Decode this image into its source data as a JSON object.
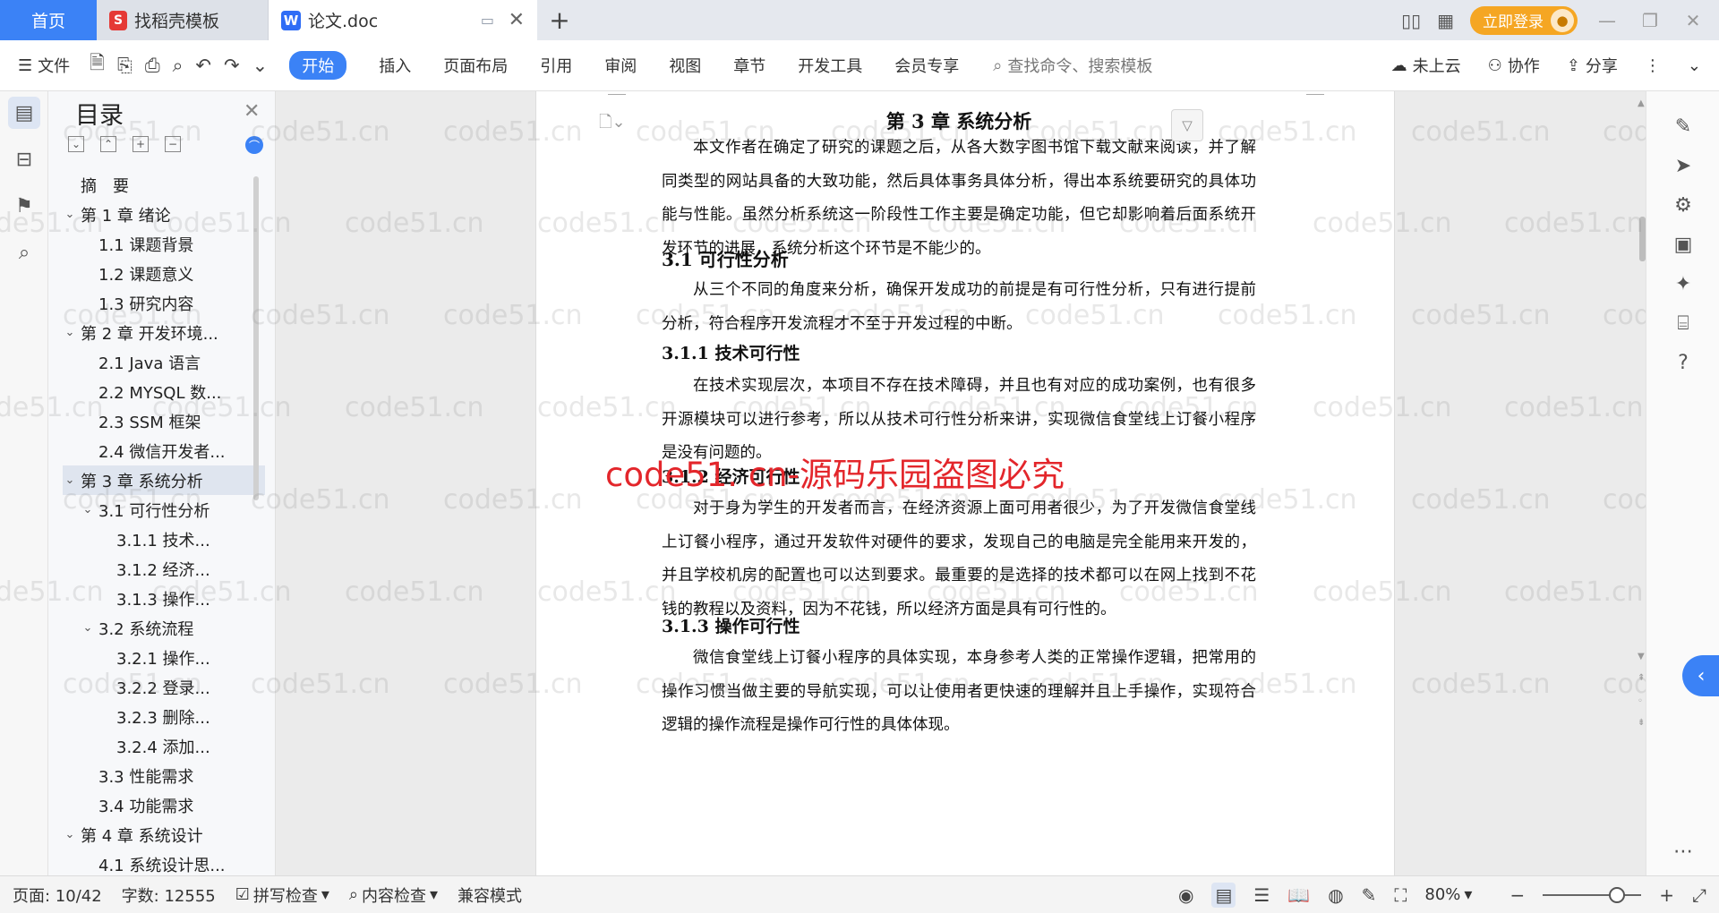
{
  "titlebar": {
    "tabs": [
      {
        "label": "首页"
      },
      {
        "label": "找稻壳模板"
      },
      {
        "label": "论文.doc"
      }
    ],
    "login_label": "立即登录"
  },
  "menubar": {
    "file_label": "文件",
    "items": [
      "开始",
      "插入",
      "页面布局",
      "引用",
      "审阅",
      "视图",
      "章节",
      "开发工具",
      "会员专享"
    ],
    "active_index": 0,
    "search_placeholder": "查找命令、搜索模板",
    "right": {
      "cloud": "未上云",
      "collab": "协作",
      "share": "分享"
    }
  },
  "toc": {
    "title": "目录",
    "items": [
      {
        "label": "摘　要",
        "level": 0,
        "arrow": ""
      },
      {
        "label": "第 1 章  绪论",
        "level": 0,
        "arrow": "v"
      },
      {
        "label": "1.1  课题背景",
        "level": 1,
        "arrow": ""
      },
      {
        "label": "1.2  课题意义",
        "level": 1,
        "arrow": ""
      },
      {
        "label": "1.3  研究内容",
        "level": 1,
        "arrow": ""
      },
      {
        "label": "第 2 章  开发环境...",
        "level": 0,
        "arrow": "v"
      },
      {
        "label": "2.1 Java 语言",
        "level": 1,
        "arrow": ""
      },
      {
        "label": "2.2 MYSQL 数...",
        "level": 1,
        "arrow": ""
      },
      {
        "label": "2.3 SSM 框架",
        "level": 1,
        "arrow": ""
      },
      {
        "label": "2.4 微信开发者...",
        "level": 1,
        "arrow": ""
      },
      {
        "label": "第 3 章  系统分析",
        "level": 0,
        "arrow": "v",
        "selected": true
      },
      {
        "label": "3.1  可行性分析",
        "level": 1,
        "arrow": "v"
      },
      {
        "label": "3.1.1  技术...",
        "level": 2,
        "arrow": ""
      },
      {
        "label": "3.1.2  经济...",
        "level": 2,
        "arrow": ""
      },
      {
        "label": "3.1.3  操作...",
        "level": 2,
        "arrow": ""
      },
      {
        "label": "3.2  系统流程",
        "level": 1,
        "arrow": "v"
      },
      {
        "label": "3.2.1  操作...",
        "level": 2,
        "arrow": ""
      },
      {
        "label": "3.2.2  登录...",
        "level": 2,
        "arrow": ""
      },
      {
        "label": "3.2.3  删除...",
        "level": 2,
        "arrow": ""
      },
      {
        "label": "3.2.4  添加...",
        "level": 2,
        "arrow": ""
      },
      {
        "label": "3.3  性能需求",
        "level": 1,
        "arrow": ""
      },
      {
        "label": "3.4  功能需求",
        "level": 1,
        "arrow": ""
      },
      {
        "label": "第 4 章  系统设计",
        "level": 0,
        "arrow": "v"
      },
      {
        "label": "4.1  系统设计思...",
        "level": 1,
        "arrow": ""
      }
    ]
  },
  "document": {
    "chapter_title": "第 3 章  系统分析",
    "p1": "本文作者在确定了研究的课题之后，从各大数字图书馆下载文献来阅读，并了解同类型的网站具备的大致功能，然后具体事务具体分析，得出本系统要研究的具体功能与性能。虽然分析系统这一阶段性工作主要是确定功能，但它却影响着后面系统开发环节的进展，系统分析这个环节是不能少的。",
    "h31": "3.1  可行性分析",
    "p2": "从三个不同的角度来分析，确保开发成功的前提是有可行性分析，只有进行提前分析，符合程序开发流程才不至于开发过程的中断。",
    "h311": "3.1.1  技术可行性",
    "p3": "在技术实现层次，本项目不存在技术障碍，并且也有对应的成功案例，也有很多开源模块可以进行参考，所以从技术可行性分析来讲，实现微信食堂线上订餐小程序是没有问题的。",
    "h312": "3.1.2  经济可行性",
    "p4": "对于身为学生的开发者而言，在经济资源上面可用者很少，为了开发微信食堂线上订餐小程序，通过开发软件对硬件的要求，发现自己的电脑是完全能用来开发的，并且学校机房的配置也可以达到要求。最重要的是选择的技术都可以在网上找到不花钱的教程以及资料，因为不花钱，所以经济方面是具有可行性的。",
    "h313": "3.1.3  操作可行性",
    "p5": "微信食堂线上订餐小程序的具体实现，本身参考人类的正常操作逻辑，把常用的操作习惯当做主要的导航实现，可以让使用者更快速的理解并且上手操作，实现符合逻辑的操作流程是操作可行性的具体体现。"
  },
  "watermark": {
    "text": "code51.cn",
    "big": "code51. cn-源码乐园盗图必究"
  },
  "statusbar": {
    "page": "页面: 10/42",
    "words": "字数: 12555",
    "spell": "拼写检查",
    "content_check": "内容检查",
    "compat": "兼容模式",
    "zoom": "80%"
  },
  "icons": [
    "menu-icon",
    "save-icon",
    "export-icon",
    "print-icon",
    "preview-icon",
    "undo-icon",
    "redo-icon",
    "search-icon",
    "cloud-icon",
    "user-icon",
    "share-icon",
    "toc-icon",
    "bookmark-icon",
    "pen-icon",
    "cursor-icon",
    "settings-icon",
    "help-icon",
    "eye-icon",
    "zoom-out-icon",
    "zoom-in-icon",
    "fullscreen-icon"
  ],
  "colors": {
    "accent": "#3b82f6",
    "login": "#f5a623",
    "watermark_red": "#e3262b"
  }
}
